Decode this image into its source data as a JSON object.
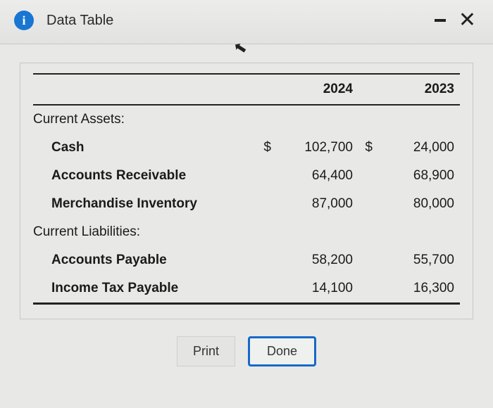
{
  "window": {
    "title": "Data Table"
  },
  "table": {
    "headers": {
      "col1": "",
      "col2": "2024",
      "col3": "2023"
    },
    "section1": {
      "label": "Current Assets:"
    },
    "rows": {
      "cash": {
        "label": "Cash",
        "cur1": "$",
        "val1": "102,700",
        "cur2": "$",
        "val2": "24,000"
      },
      "ar": {
        "label": "Accounts Receivable",
        "cur1": "",
        "val1": "64,400",
        "cur2": "",
        "val2": "68,900"
      },
      "inv": {
        "label": "Merchandise Inventory",
        "cur1": "",
        "val1": "87,000",
        "cur2": "",
        "val2": "80,000"
      }
    },
    "section2": {
      "label": "Current Liabilities:"
    },
    "rows2": {
      "ap": {
        "label": "Accounts Payable",
        "cur1": "",
        "val1": "58,200",
        "cur2": "",
        "val2": "55,700"
      },
      "tax": {
        "label": "Income Tax Payable",
        "cur1": "",
        "val1": "14,100",
        "cur2": "",
        "val2": "16,300"
      }
    }
  },
  "buttons": {
    "print": "Print",
    "done": "Done"
  }
}
